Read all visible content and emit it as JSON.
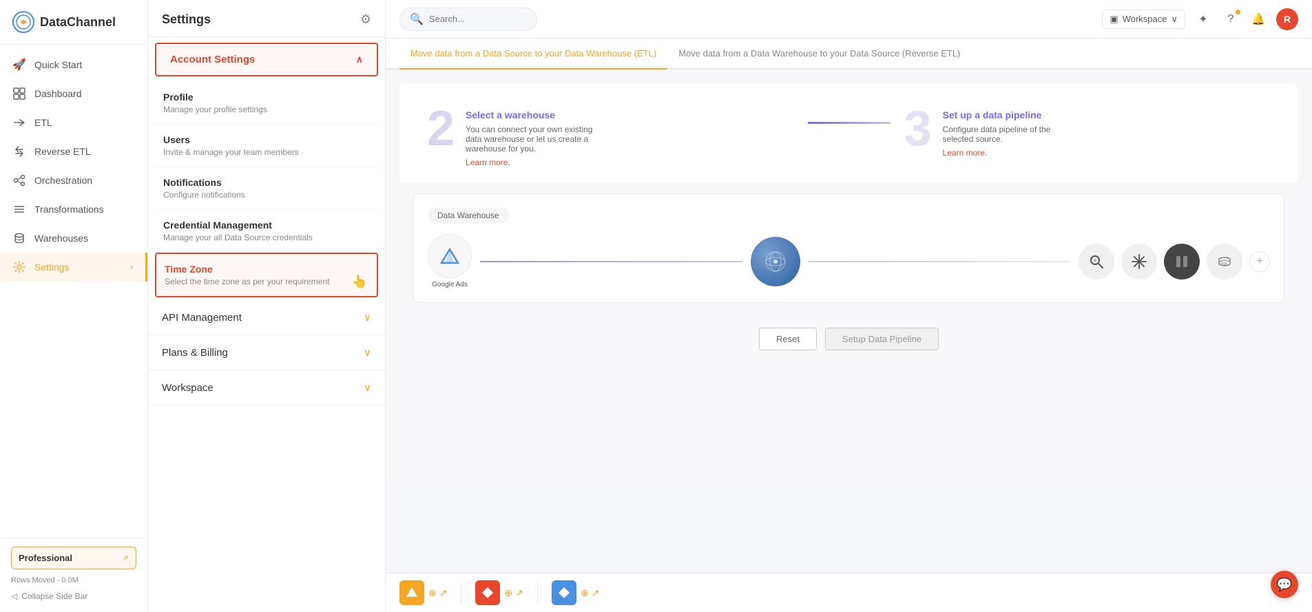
{
  "app": {
    "logo_text": "Data",
    "logo_text2": "Channel"
  },
  "sidebar": {
    "items": [
      {
        "id": "quick-start",
        "label": "Quick Start",
        "icon": "🚀"
      },
      {
        "id": "dashboard",
        "label": "Dashboard",
        "icon": "⊞"
      },
      {
        "id": "etl",
        "label": "ETL",
        "icon": "⇄"
      },
      {
        "id": "reverse-etl",
        "label": "Reverse ETL",
        "icon": "↺"
      },
      {
        "id": "orchestration",
        "label": "Orchestration",
        "icon": "⑃"
      },
      {
        "id": "transformations",
        "label": "Transformations",
        "icon": "≡"
      },
      {
        "id": "warehouses",
        "label": "Warehouses",
        "icon": "🗄"
      },
      {
        "id": "settings",
        "label": "Settings",
        "icon": "⚙",
        "active": true
      }
    ],
    "footer": {
      "plan_label": "Professional",
      "rows_moved": "Rows Moved - 0.0M",
      "collapse_label": "Collapse Side Bar"
    }
  },
  "settings_panel": {
    "title": "Settings",
    "account_settings": {
      "label": "Account Settings",
      "expanded": true,
      "items": [
        {
          "id": "profile",
          "title": "Profile",
          "description": "Manage your profile settings"
        },
        {
          "id": "users",
          "title": "Users",
          "description": "Invite & manage your team members"
        },
        {
          "id": "notifications",
          "title": "Notifications",
          "description": "Configure notifications"
        },
        {
          "id": "credential-management",
          "title": "Credential Management",
          "description": "Manage your all Data Source credentials"
        },
        {
          "id": "time-zone",
          "title": "Time Zone",
          "description": "Select the time zone as per your requirement",
          "active": true
        }
      ]
    },
    "collapsed_groups": [
      {
        "id": "api-management",
        "label": "API Management"
      },
      {
        "id": "plans-billing",
        "label": "Plans & Billing"
      },
      {
        "id": "workspace",
        "label": "Workspace"
      }
    ]
  },
  "topbar": {
    "search_placeholder": "Search...",
    "workspace_label": "Workspace",
    "avatar_initials": "R"
  },
  "content": {
    "tabs": [
      {
        "id": "etl",
        "label": "Move data from a Data Source to your Data Warehouse (ETL)",
        "active": true
      },
      {
        "id": "retl",
        "label": "Move data from a Data Warehouse to your Data Source (Reverse ETL)",
        "active": false
      }
    ],
    "steps": [
      {
        "num": "2",
        "title": "Select a warehouse",
        "desc": "You can connect your own existing data warehouse or let us create a warehouse for you.",
        "learn_label": "Learn more."
      },
      {
        "num": "3",
        "title": "Set up a data pipeline",
        "desc": "Configure data pipeline of the selected source.",
        "learn_label": "Learn more."
      }
    ],
    "warehouse": {
      "label": "Data Warehouse"
    },
    "buttons": {
      "reset": "Reset",
      "setup": "Setup Data Pipeline"
    }
  },
  "bottom_connectors": [
    {
      "color": "#f5a623",
      "icon": "▲"
    },
    {
      "color": "#e8472e",
      "icon": "⬥"
    },
    {
      "color": "#4a90e2",
      "icon": "◆"
    }
  ]
}
